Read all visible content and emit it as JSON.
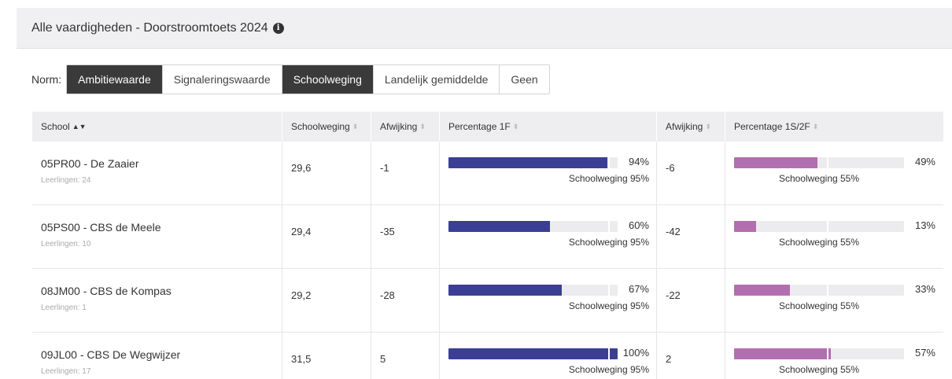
{
  "panel": {
    "title": "Alle vaardigheden - Doorstroomtoets 2024",
    "info_icon": "i"
  },
  "norm": {
    "label": "Norm:",
    "options": [
      "Ambitiewaarde",
      "Signaleringswaarde",
      "Schoolweging",
      "Landelijk gemiddelde",
      "Geen"
    ],
    "active": [
      "Ambitiewaarde",
      "Schoolweging"
    ]
  },
  "columns": {
    "school": "School",
    "schoolweging": "Schoolweging",
    "afwijking1": "Afwijking",
    "pct1f": "Percentage 1F",
    "afwijking2": "Afwijking",
    "pct1s2f": "Percentage 1S/2F",
    "sort_active": "▲▼",
    "sort_icon": "⬍"
  },
  "colors": {
    "bar_1f": "#3b3f93",
    "bar_1s2f": "#b26fb0",
    "active_button": "#3a3a3a"
  },
  "rows": [
    {
      "school": "05PR00 - De Zaaier",
      "students": "Leerlingen: 24",
      "schoolweging": "29,6",
      "afwijking1": "-1",
      "pct1f": 94,
      "pct1f_text": "94%",
      "ref1f": "Schoolweging 95%",
      "ref1f_value": 95,
      "afwijking2": "-6",
      "pct1s2f": 49,
      "pct1s2f_text": "49%",
      "ref1s2f": "Schoolweging 55%",
      "ref1s2f_value": 55
    },
    {
      "school": "05PS00 - CBS de Meele",
      "students": "Leerlingen: 10",
      "schoolweging": "29,4",
      "afwijking1": "-35",
      "pct1f": 60,
      "pct1f_text": "60%",
      "ref1f": "Schoolweging 95%",
      "ref1f_value": 95,
      "afwijking2": "-42",
      "pct1s2f": 13,
      "pct1s2f_text": "13%",
      "ref1s2f": "Schoolweging 55%",
      "ref1s2f_value": 55
    },
    {
      "school": "08JM00 - CBS de Kompas",
      "students": "Leerlingen: 1",
      "schoolweging": "29,2",
      "afwijking1": "-28",
      "pct1f": 67,
      "pct1f_text": "67%",
      "ref1f": "Schoolweging 95%",
      "ref1f_value": 95,
      "afwijking2": "-22",
      "pct1s2f": 33,
      "pct1s2f_text": "33%",
      "ref1s2f": "Schoolweging 55%",
      "ref1s2f_value": 55
    },
    {
      "school": "09JL00 - CBS De Wegwijzer",
      "students": "Leerlingen: 17",
      "schoolweging": "31,5",
      "afwijking1": "5",
      "pct1f": 100,
      "pct1f_text": "100%",
      "ref1f": "Schoolweging 95%",
      "ref1f_value": 95,
      "afwijking2": "2",
      "pct1s2f": 57,
      "pct1s2f_text": "57%",
      "ref1s2f": "Schoolweging 55%",
      "ref1s2f_value": 55
    }
  ]
}
